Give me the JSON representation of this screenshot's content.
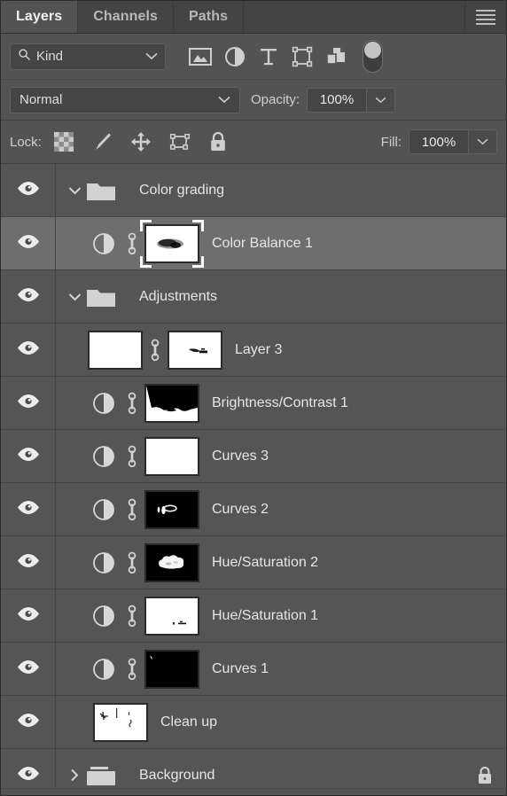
{
  "panel": {
    "title": "Layers",
    "tabs": [
      {
        "label": "Layers",
        "active": true
      },
      {
        "label": "Channels",
        "active": false
      },
      {
        "label": "Paths",
        "active": false
      }
    ],
    "menu_icon": "hamburger-menu-icon"
  },
  "filter": {
    "kind_label": "Kind",
    "search_icon": "search-icon",
    "chevron_icon": "chevron-down-icon",
    "type_filters": [
      {
        "name": "filter-pixel-layers-icon",
        "label": "Pixel layers"
      },
      {
        "name": "filter-adjustment-layers-icon",
        "label": "Adjustment layers"
      },
      {
        "name": "filter-type-layers-icon",
        "label": "Type layers"
      },
      {
        "name": "filter-shape-layers-icon",
        "label": "Shape layers"
      },
      {
        "name": "filter-smart-objects-icon",
        "label": "Smart objects"
      }
    ],
    "toggle_name": "filter-enable-toggle"
  },
  "blend": {
    "mode": "Normal",
    "opacity_label": "Opacity:",
    "opacity_value": "100%"
  },
  "lock": {
    "label": "Lock:",
    "icons": [
      {
        "name": "lock-transparent-pixels-icon",
        "label": "Lock transparent pixels"
      },
      {
        "name": "lock-image-pixels-icon",
        "label": "Lock image pixels"
      },
      {
        "name": "lock-position-icon",
        "label": "Lock position"
      },
      {
        "name": "lock-artboard-nesting-icon",
        "label": "Prevent auto-nesting"
      },
      {
        "name": "lock-all-icon",
        "label": "Lock all"
      }
    ],
    "fill_label": "Fill:",
    "fill_value": "100%"
  },
  "colors": {
    "panel_bg": "#535353",
    "row_bg": "#555555",
    "row_selected_bg": "#6e6e6e",
    "tabbar_bg": "#444444",
    "field_bg": "#454545",
    "text": "#e6e6e6",
    "muted_text": "#cfcfcf"
  },
  "layers": [
    {
      "name": "Color grading",
      "type": "group",
      "visible": true,
      "expanded": true,
      "indent": 0,
      "selected": false,
      "locked": false,
      "thumb": "folder"
    },
    {
      "name": "Color Balance 1",
      "type": "adjustment",
      "visible": true,
      "indent": 1,
      "selected": true,
      "locked": false,
      "linked": true,
      "thumb": "mask-color-balance",
      "mask_selected": true
    },
    {
      "name": "Adjustments",
      "type": "group",
      "visible": true,
      "expanded": true,
      "indent": 0,
      "selected": false,
      "locked": false,
      "thumb": "folder"
    },
    {
      "name": "Layer 3",
      "type": "pixel",
      "visible": true,
      "indent": 1,
      "selected": false,
      "locked": false,
      "linked": true,
      "thumb": "noise",
      "mask": "mask-layer3"
    },
    {
      "name": "Brightness/Contrast 1",
      "type": "adjustment",
      "visible": true,
      "indent": 1,
      "selected": false,
      "locked": false,
      "linked": true,
      "thumb": "mask-brightness"
    },
    {
      "name": "Curves 3",
      "type": "adjustment",
      "visible": true,
      "indent": 1,
      "selected": false,
      "locked": false,
      "linked": true,
      "thumb": "mask-white"
    },
    {
      "name": "Curves 2",
      "type": "adjustment",
      "visible": true,
      "indent": 1,
      "selected": false,
      "locked": false,
      "linked": true,
      "thumb": "mask-curves2"
    },
    {
      "name": "Hue/Saturation 2",
      "type": "adjustment",
      "visible": true,
      "indent": 1,
      "selected": false,
      "locked": false,
      "linked": true,
      "thumb": "mask-huesat2"
    },
    {
      "name": "Hue/Saturation 1",
      "type": "adjustment",
      "visible": true,
      "indent": 1,
      "selected": false,
      "locked": false,
      "linked": true,
      "thumb": "mask-huesat1"
    },
    {
      "name": "Curves 1",
      "type": "adjustment",
      "visible": true,
      "indent": 1,
      "selected": false,
      "locked": false,
      "linked": true,
      "thumb": "mask-curves1"
    },
    {
      "name": "Clean up",
      "type": "pixel",
      "visible": true,
      "indent": 0,
      "selected": false,
      "locked": false,
      "linked": false,
      "thumb": "transparent"
    },
    {
      "name": "Background",
      "type": "group",
      "visible": true,
      "expanded": false,
      "indent": 0,
      "selected": false,
      "locked": true,
      "thumb": "folder"
    }
  ]
}
